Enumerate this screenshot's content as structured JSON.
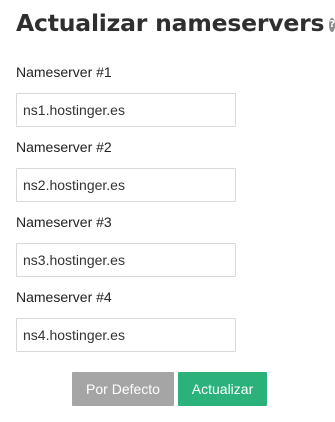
{
  "header": {
    "title": "Actualizar nameservers",
    "help_icon": "question-circle-icon",
    "help_glyph": "?"
  },
  "fields": [
    {
      "label": "Nameserver #1",
      "value": "ns1.hostinger.es"
    },
    {
      "label": "Nameserver #2",
      "value": "ns2.hostinger.es"
    },
    {
      "label": "Nameserver #3",
      "value": "ns3.hostinger.es"
    },
    {
      "label": "Nameserver #4",
      "value": "ns4.hostinger.es"
    }
  ],
  "actions": {
    "default_label": "Por Defecto",
    "submit_label": "Actualizar"
  },
  "colors": {
    "primary": "#2bb27b",
    "secondary": "#a5a5a5",
    "title": "#2f2f2f"
  }
}
